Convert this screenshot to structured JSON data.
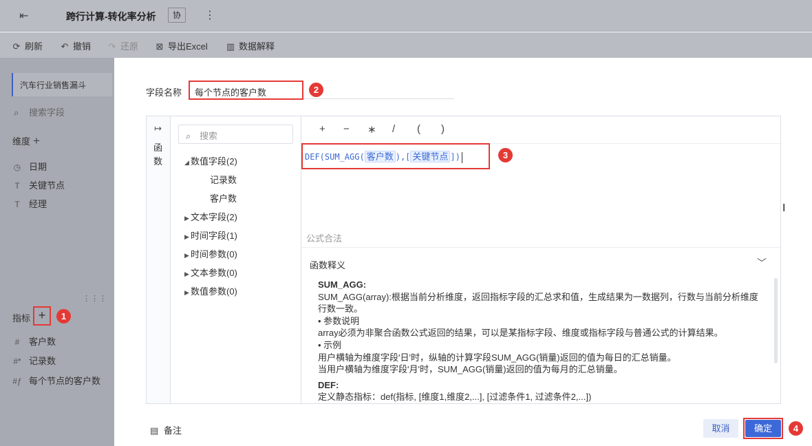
{
  "header": {
    "title": "跨行计算-转化率分析",
    "collab_label": "协",
    "more_icon": "⋮"
  },
  "toolbar": {
    "refresh": "刷新",
    "undo": "撤销",
    "redo": "还原",
    "export": "导出Excel",
    "explain": "数据解释"
  },
  "sidebar": {
    "dataset": "汽车行业销售漏斗",
    "search_placeholder": "搜索字段",
    "dimension_title": "维度",
    "dimensions": [
      {
        "label": "日期",
        "icon": "clock-icon"
      },
      {
        "label": "关键节点",
        "icon": "text-icon"
      },
      {
        "label": "经理",
        "icon": "text-icon"
      }
    ],
    "measure_title": "指标",
    "measures": [
      {
        "label": "客户数",
        "icon": "hash-icon"
      },
      {
        "label": "记录数",
        "icon": "hash-star-icon"
      },
      {
        "label": "每个节点的客户数",
        "icon": "hash-calc-icon"
      }
    ]
  },
  "dialog": {
    "field_name_label": "字段名称",
    "field_name_value": "每个节点的客户数",
    "function_tab": "函数",
    "tree_search_placeholder": "搜索",
    "tree": {
      "numeric": "数值字段(2)",
      "numeric_children": [
        "记录数",
        "客户数"
      ],
      "text": "文本字段(2)",
      "time": "时间字段(1)",
      "time_param": "时间参数(0)",
      "text_param": "文本参数(0)",
      "numeric_param": "数值参数(0)"
    },
    "operators": [
      "+",
      "−",
      "∗",
      "/",
      "(",
      ")"
    ],
    "formula": {
      "prefix": "DEF(SUM_AGG(",
      "token1": "客户数",
      "middle": "),[",
      "token2": "关键节点",
      "suffix": "])"
    },
    "valid_text": "公式合法",
    "explanation_title": "函数释义",
    "explanation": {
      "h1": "SUM_AGG:",
      "l1": "SUM_AGG(array):根据当前分析维度，返回指标字段的汇总求和值，生成结果为一数据列，行数与当前分析维度行数一致。",
      "l2": "• 参数说明",
      "l3": "array必须为非聚合函数公式返回的结果，可以是某指标字段、维度或指标字段与普通公式的计算结果。",
      "l4": "• 示例",
      "l5": "用户横轴为维度字段'日'时，纵轴的计算字段SUM_AGG(销量)返回的值为每日的汇总销量。",
      "l6": "当用户横轴为维度字段'月'时，SUM_AGG(销量)返回的值为每月的汇总销量。",
      "h2": "DEF:",
      "l7": "定义静态指标：def(指标, [维度1,维度2,...], [过滤条件1, 过滤条件2,...])"
    },
    "remark": "备注",
    "cancel": "取消",
    "ok": "确定"
  },
  "badges": [
    "1",
    "2",
    "3",
    "4"
  ]
}
